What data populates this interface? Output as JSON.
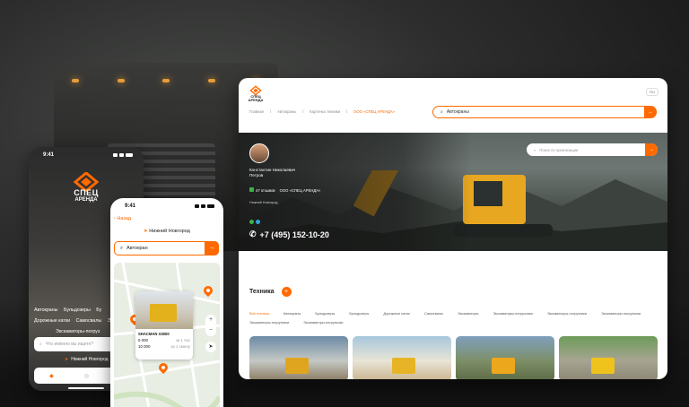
{
  "phone1": {
    "time": "9:41",
    "brand_line1": "СПЕЦ",
    "brand_line2": "АРЕНДА",
    "categories": [
      "Автокраны",
      "Бульдозеры",
      "Бу",
      "Дорожные катки",
      "Самосвалы",
      "Э",
      "Экскаваторы-погруз"
    ],
    "search_placeholder": "Что именно вы ищете?",
    "city": "Нижний Новгород"
  },
  "phone2": {
    "time": "9:41",
    "back_label": "Назад",
    "city": "Нижний Новгород",
    "search_value": "Автокран",
    "card": {
      "title": "SHACMAN X3000",
      "rows": [
        {
          "price": "5 000",
          "unit": "за 1 час"
        },
        {
          "price": "10 000",
          "unit": "за 1 смену"
        }
      ]
    }
  },
  "desktop": {
    "brand_line1": "СПЕЦ",
    "brand_line2": "АРЕНДА",
    "lang": "RU",
    "breadcrumbs": [
      "Главная",
      "/",
      "Автокраны",
      "/",
      "Карточка техники",
      "/",
      "ООО «СПЕЦ АРЕНДА»"
    ],
    "search_value": "Автокраны",
    "hero": {
      "name_line1": "Константин Николаевич",
      "name_line2": "Петров",
      "badge1": "47 отзывов",
      "badge2": "ООО «СПЕЦ АРЕНДА»",
      "note": "Нижний Новгород",
      "phone": "+7 (495) 152-10-20",
      "search_placeholder": "Поиск по организации"
    },
    "section_title": "Техника",
    "filter_tabs": [
      "Вся техника",
      "Автокраны",
      "Бульдозеры",
      "Бульдозеры",
      "Дорожные катки",
      "Самосвалы",
      "Экскаваторы",
      "Экскаваторы-погрузчики",
      "Экскаваторы-погрузчики",
      "Экскаваторы-погрузчики",
      "Экскаваторы-погрузчики",
      "Экскаваторы-погрузчики"
    ]
  },
  "colors": {
    "accent": "#ff6a00",
    "dark_bg": "#1d1d1d"
  }
}
